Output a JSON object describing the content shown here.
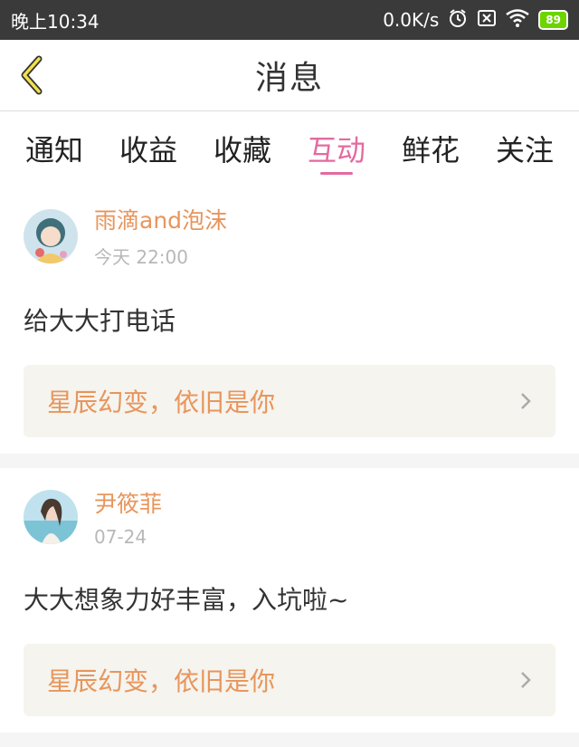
{
  "status_bar": {
    "time": "晚上10:34",
    "speed": "0.0K/s",
    "battery": "89"
  },
  "header": {
    "title": "消息"
  },
  "tabs": [
    {
      "label": "通知",
      "active": false
    },
    {
      "label": "收益",
      "active": false
    },
    {
      "label": "收藏",
      "active": false
    },
    {
      "label": "互动",
      "active": true
    },
    {
      "label": "鲜花",
      "active": false
    },
    {
      "label": "关注",
      "active": false
    }
  ],
  "messages": [
    {
      "username": "雨滴and泡沫",
      "time": "今天 22:00",
      "comment": "给大大打电话",
      "book_title": "星辰幻变，依旧是你"
    },
    {
      "username": "尹筱菲",
      "time": "07-24",
      "comment": "大大想象力好丰富，入坑啦~",
      "book_title": "星辰幻变，依旧是你"
    }
  ],
  "colors": {
    "accent_tab": "#e46aa0",
    "username": "#e8955c",
    "status_bar": "#3a3a3a"
  }
}
